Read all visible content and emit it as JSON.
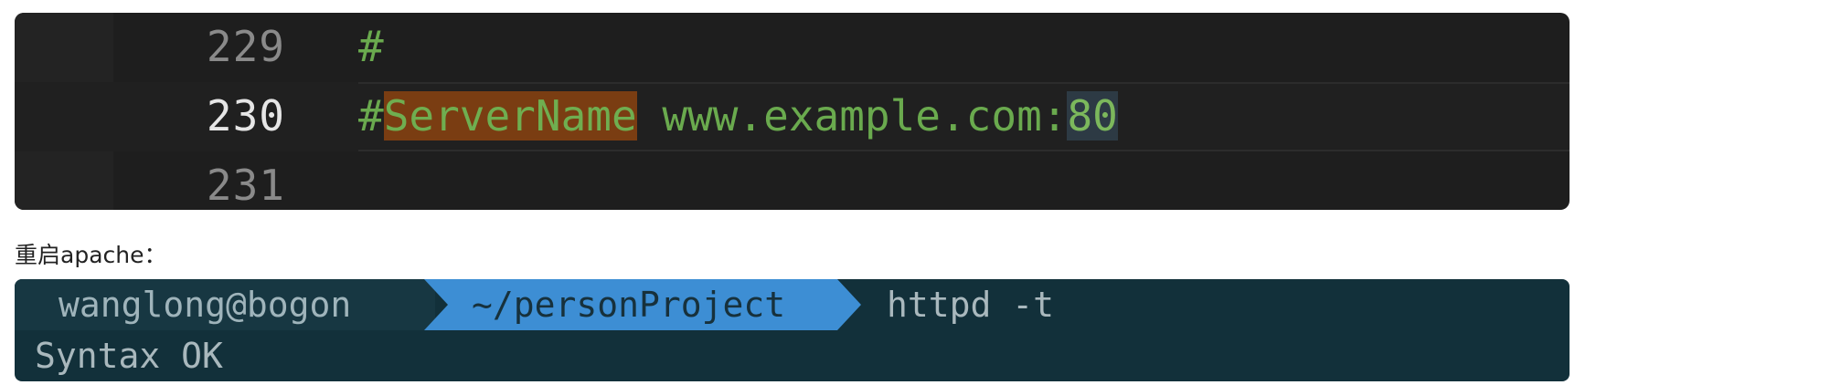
{
  "editor": {
    "lines": [
      {
        "number": "229",
        "code": "#"
      },
      {
        "number": "230",
        "hash": "#",
        "directive": "ServerName",
        "value_host": " www.example.com:",
        "value_port": "80"
      },
      {
        "number": "231",
        "code": ""
      }
    ],
    "colors": {
      "background": "#1e1e1e",
      "comment_text": "#6aaa4e",
      "search_highlight": "#7a3d12",
      "selection_highlight": "#2d3a44"
    }
  },
  "caption": "重启apache：",
  "terminal": {
    "user_host": "wanglong@bogon",
    "cwd": "~/personProject",
    "command": "httpd -t",
    "output": "Syntax OK",
    "colors": {
      "background": "#12303a",
      "path_segment": "#3d8ed4"
    }
  }
}
